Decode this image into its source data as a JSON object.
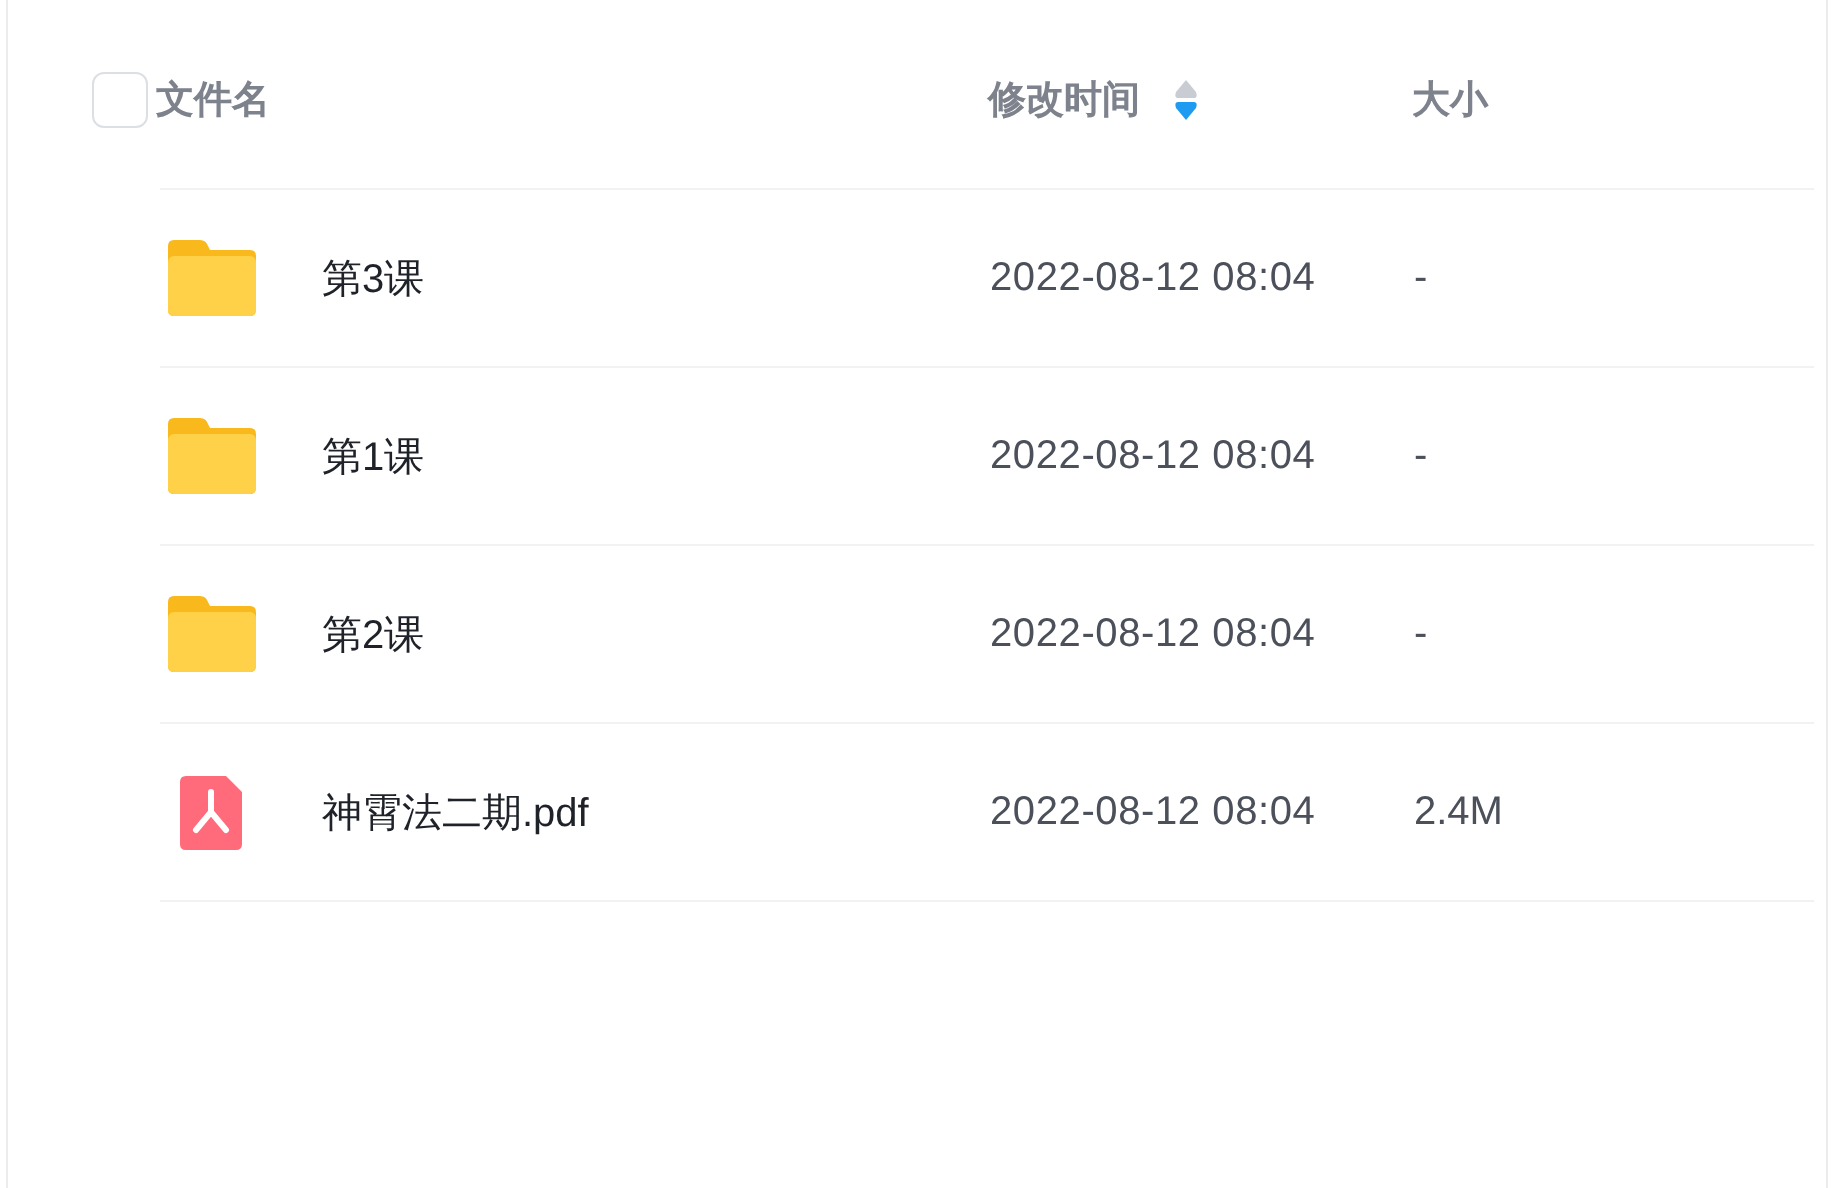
{
  "header": {
    "select_all": {
      "checked": false
    },
    "columns": [
      {
        "label": "文件名",
        "kind": "name"
      },
      {
        "label": "修改时间",
        "kind": "time",
        "sorted": true,
        "descending": true
      },
      {
        "label": "大小",
        "kind": "size"
      }
    ]
  },
  "rows": [
    {
      "kind": "folder",
      "name": "第3课",
      "modified": "2022-08-12 08:04",
      "size": "-"
    },
    {
      "kind": "folder",
      "name": "第1课",
      "modified": "2022-08-12 08:04",
      "size": "-"
    },
    {
      "kind": "folder",
      "name": "第2课",
      "modified": "2022-08-12 08:04",
      "size": "-"
    },
    {
      "kind": "pdf",
      "name": "神霄法二期.pdf",
      "modified": "2022-08-12 08:04",
      "size": "2.4M"
    }
  ]
}
